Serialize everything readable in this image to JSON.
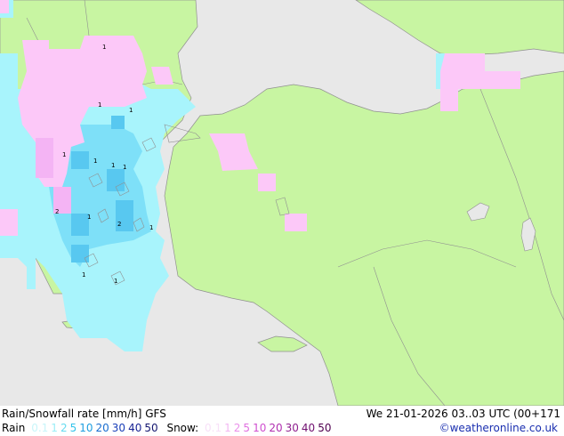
{
  "title": "Rain/Snowfall rate [mm/h] GFS",
  "datetime": "We 21-01-2026 03..03 UTC (00+171",
  "credit": "©weatheronline.co.uk",
  "rain_legend": {
    "label": "Rain",
    "values": [
      {
        "text": "0.1",
        "color": "#c8f5fa"
      },
      {
        "text": "1",
        "color": "#9aeef7"
      },
      {
        "text": "2",
        "color": "#66dbf0"
      },
      {
        "text": "5",
        "color": "#33c3ea"
      },
      {
        "text": "10",
        "color": "#1e9fe0"
      },
      {
        "text": "20",
        "color": "#1a6ed0"
      },
      {
        "text": "30",
        "color": "#1a3fb8"
      },
      {
        "text": "40",
        "color": "#1a2595"
      },
      {
        "text": "50",
        "color": "#141670"
      }
    ]
  },
  "snow_legend": {
    "label": "Snow:",
    "values": [
      {
        "text": "0.1",
        "color": "#f8e0f8"
      },
      {
        "text": "1",
        "color": "#f2b8f2"
      },
      {
        "text": "2",
        "color": "#ea90ea"
      },
      {
        "text": "5",
        "color": "#e070e0"
      },
      {
        "text": "10",
        "color": "#d050d0"
      },
      {
        "text": "20",
        "color": "#b030b0"
      },
      {
        "text": "30",
        "color": "#902090"
      },
      {
        "text": "40",
        "color": "#701070"
      },
      {
        "text": "50",
        "color": "#500050"
      }
    ]
  },
  "colors": {
    "land": "#c8f5a2",
    "sea": "#e8e8e8",
    "border": "#909090",
    "rain_light": "#a8f4fc",
    "rain_mid": "#7ee0f8",
    "rain_strong": "#58c8f0",
    "snow_light": "#fcc8f8",
    "snow_mid": "#f4b4f4"
  },
  "map_labels": [
    "1",
    "1",
    "1",
    "1",
    "1",
    "1",
    "1",
    "2",
    "1",
    "2",
    "1",
    "1",
    "1"
  ]
}
